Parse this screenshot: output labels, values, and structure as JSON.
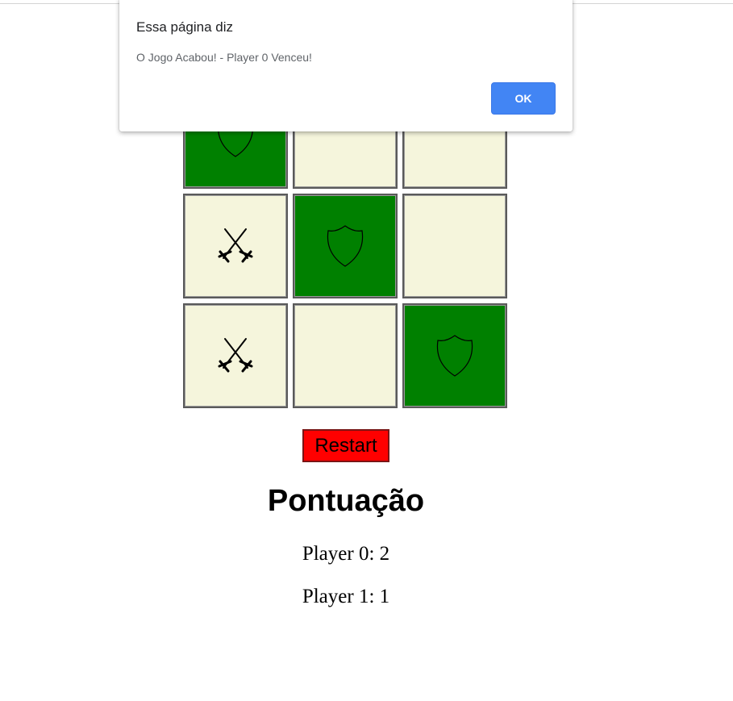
{
  "board": {
    "cells": [
      {
        "mark": "shield",
        "state": "win"
      },
      {
        "mark": "",
        "state": "empty"
      },
      {
        "mark": "",
        "state": "empty"
      },
      {
        "mark": "swords",
        "state": "empty"
      },
      {
        "mark": "shield",
        "state": "win"
      },
      {
        "mark": "",
        "state": "empty"
      },
      {
        "mark": "swords",
        "state": "empty"
      },
      {
        "mark": "",
        "state": "empty"
      },
      {
        "mark": "shield",
        "state": "win"
      }
    ],
    "colors": {
      "empty": "#f5f5dc",
      "win": "#008000"
    }
  },
  "restart_label": "Restart",
  "restart_color": "#ff0000",
  "score": {
    "title": "Pontuação",
    "player0": "Player 0: 2",
    "player1": "Player 1: 1"
  },
  "dialog": {
    "title": "Essa página diz",
    "message": "O Jogo Acabou! - Player 0 Venceu!",
    "ok_label": "OK",
    "ok_color": "#4285f4"
  }
}
